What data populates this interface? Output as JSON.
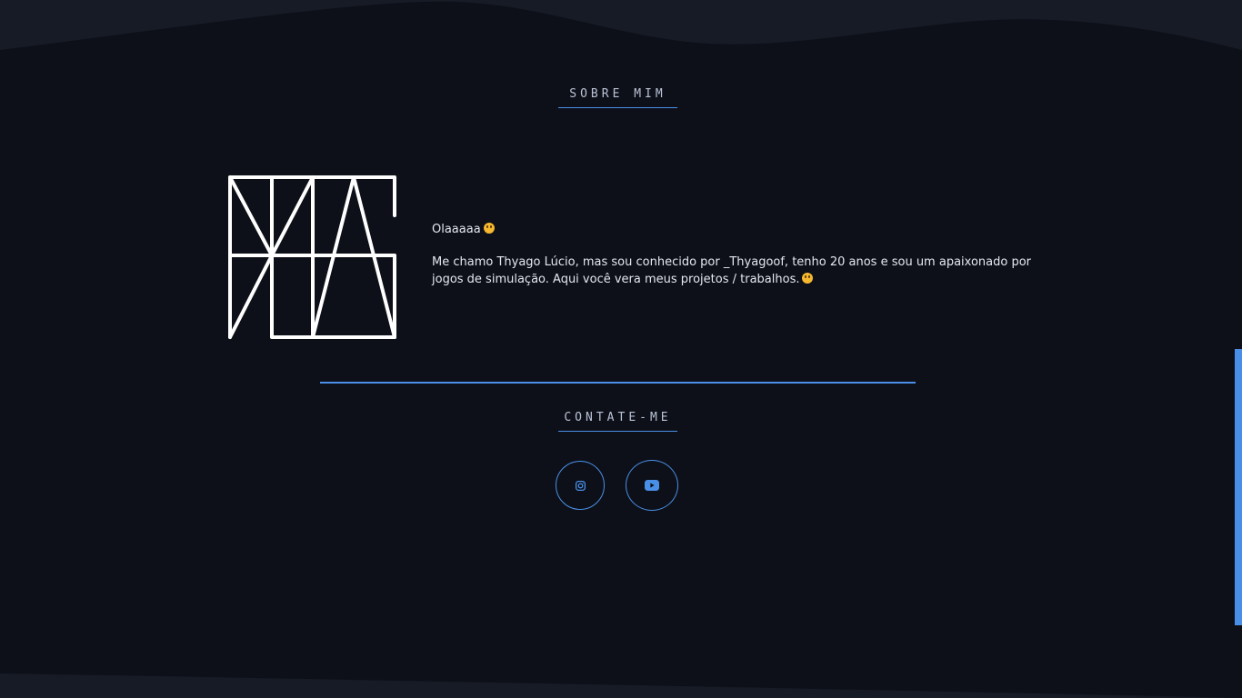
{
  "about": {
    "heading": "SOBRE MIM",
    "greeting": "Olaaaaa",
    "bio": "Me chamo Thyago Lúcio, mas sou conhecido por _Thyagoof, tenho 20 anos e sou um apaixonado por jogos de simulação. Aqui você vera meus projetos / trabalhos."
  },
  "contact": {
    "heading": "CONTATE-ME",
    "links": [
      {
        "icon": "instagram-icon"
      },
      {
        "icon": "youtube-icon"
      }
    ]
  },
  "colors": {
    "background": "#0d1018",
    "accent": "#4a8fe7",
    "wave": "#161b26",
    "text": "#e4e7ef"
  }
}
